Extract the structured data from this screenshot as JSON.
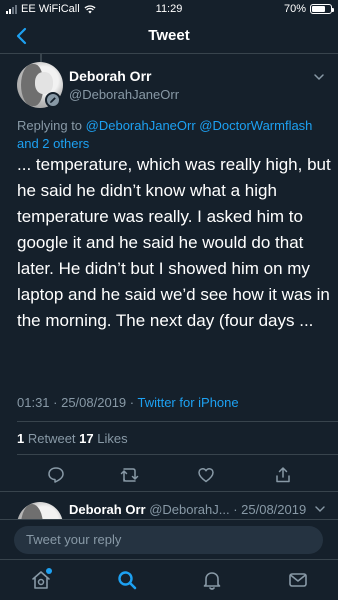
{
  "status_bar": {
    "carrier": "EE WiFiCall",
    "time": "11:29",
    "battery": "70%",
    "battery_level": 0.7
  },
  "nav": {
    "title": "Tweet"
  },
  "tweet": {
    "author_name": "Deborah Orr",
    "author_handle": "@DeborahJaneOrr",
    "replying_prefix": "Replying to ",
    "replying_handles": "@DeborahJaneOrr @DoctorWarmflash",
    "replying_suffix": "and 2 others",
    "text": "... temperature, which was really high, but he said he didn’t know what a high temperature was really. I asked him to google it and he said he would do that later. He didn’t but I showed him on my laptop and he said we’d see how it was in the morning. The next day (four days ...",
    "time": "01:31 · 25/08/2019 · ",
    "source": "Twitter for iPhone",
    "retweet_count": "1",
    "retweet_label": " Retweet ",
    "like_count": "17",
    "like_label": " Likes"
  },
  "next_tweet": {
    "author_name": "Deborah Orr",
    "author_handle_date": " @DeborahJ... · 25/08/2019"
  },
  "reply": {
    "placeholder": "Tweet your reply"
  },
  "icons": {
    "back": "chevron-left-icon",
    "caret": "chevron-down-icon",
    "reply": "comment-icon",
    "retweet": "retweet-icon",
    "like": "heart-icon",
    "share": "share-icon",
    "home": "home-icon",
    "search": "search-icon",
    "notifications": "bell-icon",
    "messages": "mail-icon"
  },
  "colors": {
    "background": "#15202b",
    "accent": "#1da1f2",
    "secondary_text": "#8899a6",
    "divider": "#38444d"
  }
}
